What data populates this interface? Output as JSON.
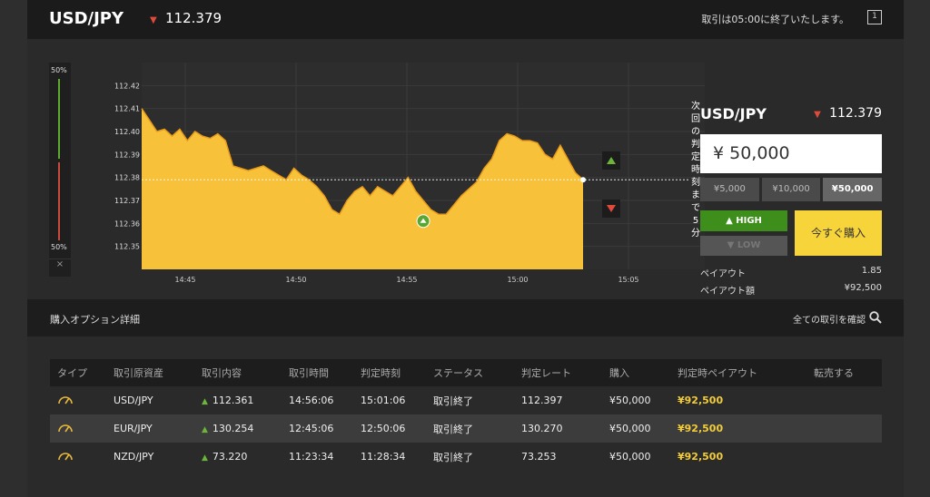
{
  "header": {
    "pair": "USD/JPY",
    "rate": "112.379",
    "message": "取引は05:00に終了いたします。",
    "window_icon_label": "1"
  },
  "gauge": {
    "top_label": "50%",
    "bottom_label": "50%",
    "close_label": "×"
  },
  "chart_data": {
    "type": "area",
    "title": "",
    "y_ticks": [
      "112.42",
      "112.41",
      "112.40",
      "112.39",
      "112.38",
      "112.37",
      "112.36",
      "112.35"
    ],
    "x_ticks": [
      "14:45",
      "14:50",
      "14:55",
      "15:00",
      "15:05"
    ],
    "ylim": [
      112.34,
      112.43
    ],
    "current_rate": 112.379,
    "entry_point": {
      "x": "14:56",
      "y": 112.361
    },
    "side_text": "次回の判定時刻まで5分",
    "series": [
      {
        "values": [
          112.41,
          112.405,
          112.4,
          112.401,
          112.398,
          112.401,
          112.396,
          112.4,
          112.398,
          112.397,
          112.399,
          112.396,
          112.385,
          112.384,
          112.383,
          112.384,
          112.385,
          112.383,
          112.381,
          112.379,
          112.384,
          112.381,
          112.379,
          112.376,
          112.372,
          112.366,
          112.364,
          112.37,
          112.374,
          112.376,
          112.372,
          112.376,
          112.374,
          112.372,
          112.376,
          112.38,
          112.374,
          112.37,
          112.366,
          112.364,
          112.364,
          112.368,
          112.372,
          112.375,
          112.378,
          112.384,
          112.388,
          112.396,
          112.399,
          112.398,
          112.396,
          112.396,
          112.395,
          112.39,
          112.388,
          112.394,
          112.388,
          112.382,
          112.379
        ]
      }
    ],
    "colors": {
      "fill": "#f7c23a",
      "stroke": "#e89b1a",
      "grid": "#3a3a3a"
    }
  },
  "panel": {
    "pair": "USD/JPY",
    "rate": "112.379",
    "amount": "¥ 50,000",
    "presets": [
      "¥5,000",
      "¥10,000",
      "¥50,000"
    ],
    "high_label": "HIGH",
    "low_label": "LOW",
    "buy_label": "今すぐ購入",
    "payout_label": "ペイアウト",
    "payout_value": "1.85",
    "payout_amount_label": "ペイアウト額",
    "payout_amount_value": "¥92,500"
  },
  "details": {
    "title": "購入オプション詳細",
    "view_all": "全ての取引を確認",
    "columns": [
      "タイプ",
      "取引原資産",
      "取引内容",
      "取引時間",
      "判定時刻",
      "ステータス",
      "判定レート",
      "購入",
      "判定時ペイアウト",
      "転売する"
    ],
    "rows": [
      {
        "asset": "USD/JPY",
        "entry": "112.361",
        "time": "14:56:06",
        "expiry": "15:01:06",
        "status": "取引終了",
        "rate": "112.397",
        "amount": "¥50,000",
        "payout": "¥92,500"
      },
      {
        "asset": "EUR/JPY",
        "entry": "130.254",
        "time": "12:45:06",
        "expiry": "12:50:06",
        "status": "取引終了",
        "rate": "130.270",
        "amount": "¥50,000",
        "payout": "¥92,500"
      },
      {
        "asset": "NZD/JPY",
        "entry": "73.220",
        "time": "11:23:34",
        "expiry": "11:28:34",
        "status": "取引終了",
        "rate": "73.253",
        "amount": "¥50,000",
        "payout": "¥92,500"
      }
    ]
  }
}
